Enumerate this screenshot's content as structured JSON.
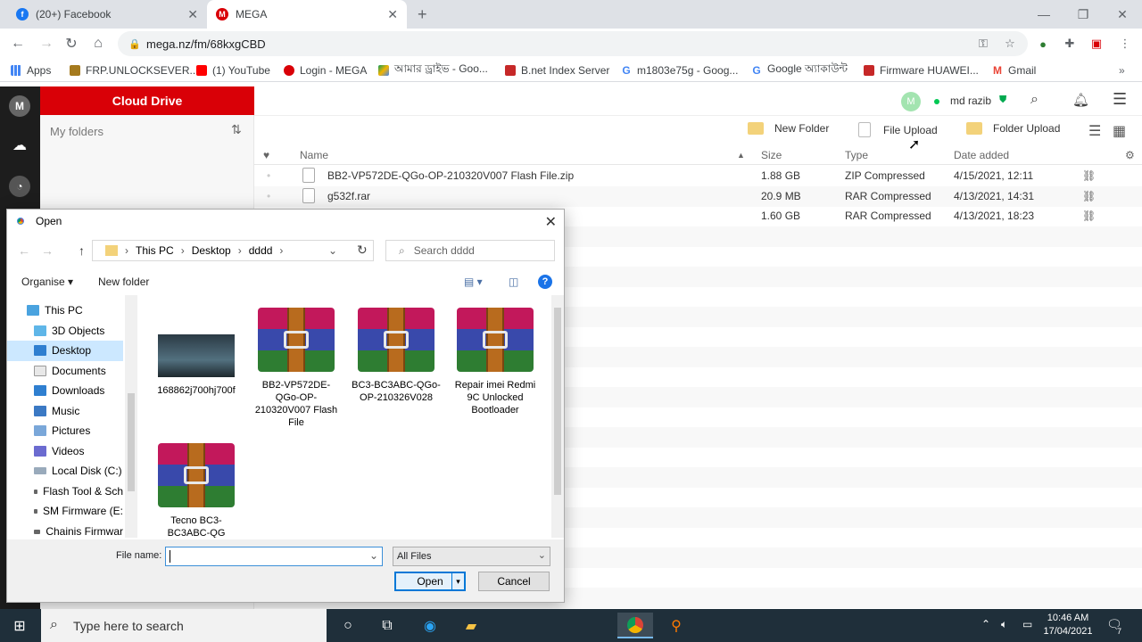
{
  "browser": {
    "tabs": [
      {
        "label": "(20+) Facebook",
        "icon": "facebook-icon",
        "color": "#1877f2"
      },
      {
        "label": "MEGA",
        "icon": "mega-icon",
        "color": "#d90007"
      }
    ],
    "new_tab_icon": "plus-icon",
    "url": "mega.nz/fm/68kxgCBD"
  },
  "bookmarks": [
    {
      "label": "Apps",
      "icon": "apps-grid-icon"
    },
    {
      "label": "FRP.UNLOCKSEVER....",
      "icon": "bookmark-favicon"
    },
    {
      "label": "(1) YouTube",
      "icon": "youtube-icon"
    },
    {
      "label": "Login - MEGA",
      "icon": "mega-icon"
    },
    {
      "label": "আমার ড্রাইভ - Goo...",
      "icon": "google-drive-icon"
    },
    {
      "label": "B.net Index Server",
      "icon": "bookmark-favicon"
    },
    {
      "label": "m1803e75g - Goog...",
      "icon": "google-icon"
    },
    {
      "label": "Google অ্যাকাউন্ট",
      "icon": "google-icon"
    },
    {
      "label": "Firmware HUAWEI...",
      "icon": "bookmark-favicon"
    },
    {
      "label": "Gmail",
      "icon": "gmail-icon"
    }
  ],
  "mega": {
    "cloud_drive": "Cloud Drive",
    "my_folders": "My folders",
    "avatar_letter": "M",
    "user_name": "md razib",
    "actions": {
      "new_folder": "New Folder",
      "file_upload": "File Upload",
      "folder_upload": "Folder Upload"
    },
    "columns": {
      "name": "Name",
      "size": "Size",
      "type": "Type",
      "date": "Date added"
    },
    "files": [
      {
        "name": "BB2-VP572DE-QGo-OP-210320V007 Flash File.zip",
        "size": "1.88 GB",
        "type": "ZIP Compressed",
        "date": "4/15/2021, 12:11"
      },
      {
        "name": "g532f.rar",
        "size": "20.9 MB",
        "type": "RAR Compressed",
        "date": "4/13/2021, 14:31"
      },
      {
        "name": "",
        "size": "1.60 GB",
        "type": "RAR Compressed",
        "date": "4/13/2021, 18:23"
      }
    ]
  },
  "dialog": {
    "title": "Open",
    "path": [
      "This PC",
      "Desktop",
      "dddd"
    ],
    "search_placeholder": "Search dddd",
    "organise": "Organise ▾",
    "new_folder": "New folder",
    "nav": [
      {
        "label": "This PC",
        "icon": "computer-icon"
      },
      {
        "label": "3D Objects",
        "icon": "3d-objects-icon"
      },
      {
        "label": "Desktop",
        "icon": "desktop-icon"
      },
      {
        "label": "Documents",
        "icon": "documents-icon"
      },
      {
        "label": "Downloads",
        "icon": "downloads-icon"
      },
      {
        "label": "Music",
        "icon": "music-icon"
      },
      {
        "label": "Pictures",
        "icon": "pictures-icon"
      },
      {
        "label": "Videos",
        "icon": "videos-icon"
      },
      {
        "label": "Local Disk (C:)",
        "icon": "drive-icon"
      },
      {
        "label": "Flash Tool & Sch",
        "icon": "drive-icon"
      },
      {
        "label": "SM Firmware (E:",
        "icon": "drive-icon"
      },
      {
        "label": "Chainis Firmwar",
        "icon": "drive-icon"
      }
    ],
    "files": [
      {
        "name": "168862j700hj700f",
        "kind": "image"
      },
      {
        "name": "BB2-VP572DE-QGo-OP-210320V007 Flash File",
        "kind": "rar"
      },
      {
        "name": "BC3-BC3ABC-QGo-OP-210326V028",
        "kind": "rar"
      },
      {
        "name": "Repair imei Redmi 9C Unlocked Bootloader",
        "kind": "rar"
      },
      {
        "name": "Tecno BC3-BC3ABC-QG",
        "kind": "rar"
      }
    ],
    "file_name_label": "File name:",
    "file_name_value": "",
    "filter": "All Files",
    "open_button": "Open",
    "cancel_button": "Cancel"
  },
  "taskbar": {
    "search_placeholder": "Type here to search",
    "time": "10:46 AM",
    "date": "17/04/2021",
    "notification_count": "7"
  }
}
